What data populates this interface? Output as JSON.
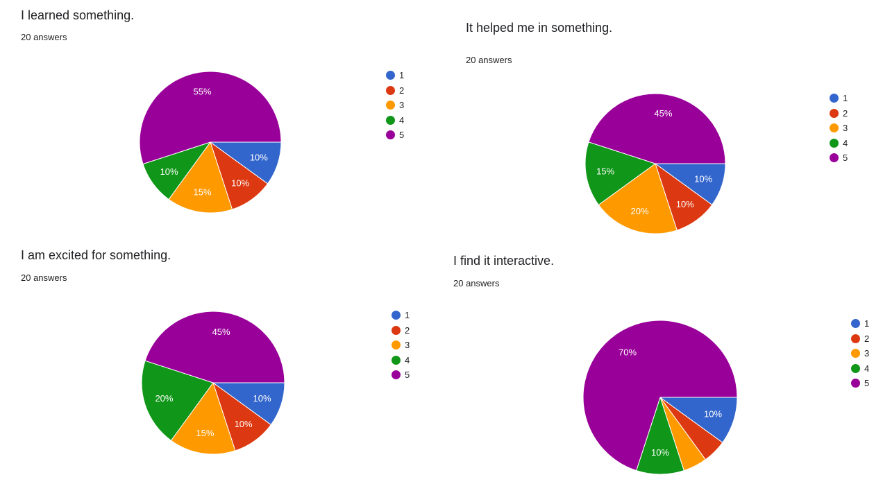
{
  "charts": [
    {
      "title": "I learned something.",
      "count": "20 answers",
      "chart_data": {
        "type": "pie",
        "title": "I learned something.",
        "categories": [
          "1",
          "2",
          "3",
          "4",
          "5"
        ],
        "values": [
          10,
          10,
          15,
          10,
          55
        ],
        "value_labels": [
          "10%",
          "10%",
          "15%",
          "10%",
          "55%"
        ],
        "legend": "right"
      }
    },
    {
      "title": "It helped me in something.",
      "count": "20 answers",
      "chart_data": {
        "type": "pie",
        "title": "It helped me in something.",
        "categories": [
          "1",
          "2",
          "3",
          "4",
          "5"
        ],
        "values": [
          10,
          10,
          20,
          15,
          45
        ],
        "value_labels": [
          "10%",
          "10%",
          "20%",
          "15%",
          "45%"
        ],
        "legend": "right"
      }
    },
    {
      "title": "I am excited for something.",
      "count": "20 answers",
      "chart_data": {
        "type": "pie",
        "title": "I am excited for something.",
        "categories": [
          "1",
          "2",
          "3",
          "4",
          "5"
        ],
        "values": [
          10,
          10,
          15,
          20,
          45
        ],
        "value_labels": [
          "10%",
          "10%",
          "15%",
          "20%",
          "45%"
        ],
        "legend": "right"
      }
    },
    {
      "title": "I find it interactive.",
      "count": "20 answers",
      "chart_data": {
        "type": "pie",
        "title": "I find it interactive.",
        "categories": [
          "1",
          "2",
          "3",
          "4",
          "5"
        ],
        "values": [
          10,
          5,
          5,
          10,
          70
        ],
        "value_labels": [
          "10%",
          "",
          "",
          "10%",
          "70%"
        ],
        "legend": "right"
      }
    }
  ],
  "colors": [
    "#3366cc",
    "#dc3912",
    "#ff9900",
    "#109618",
    "#990099"
  ]
}
